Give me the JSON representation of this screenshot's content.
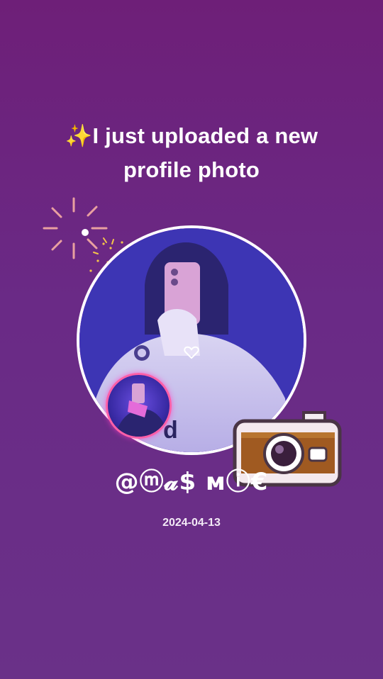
{
  "headline": {
    "line1": "✨I just uploaded a new",
    "line2": "profile photo"
  },
  "profile": {
    "username": "@ⓜ𝓪$ ᴍⓘ€",
    "date": "2024-04-13"
  },
  "icons": {
    "sparkle": "sparkle-burst-icon",
    "heart": "heart-icon",
    "camera": "camera-icon"
  },
  "colors": {
    "background_top": "#6e1f78",
    "background_bottom": "#6a3188",
    "ring_glow": "#e33be6",
    "mini_ring": "#ff5fa8",
    "camera_body": "#9b4f1f"
  }
}
